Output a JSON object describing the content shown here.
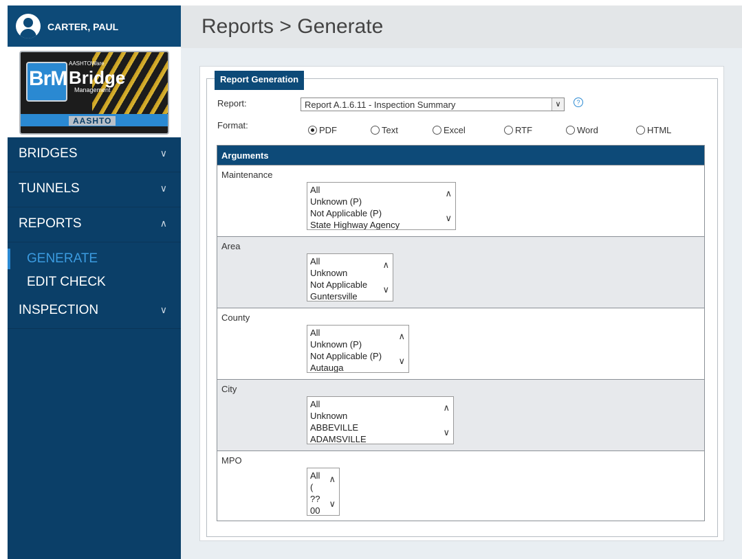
{
  "user": {
    "name": "CARTER, PAUL",
    "icon": "user-avatar-icon"
  },
  "logo": {
    "badge": "BrM",
    "brand_small": "AASHTOWare",
    "brand": "Bridge",
    "sub": "Management",
    "org": "AASHTO"
  },
  "nav": {
    "items": [
      {
        "label": "BRIDGES",
        "chevron": "⌵"
      },
      {
        "label": "TUNNELS",
        "chevron": "⌵"
      },
      {
        "label": "REPORTS",
        "chevron": "^"
      },
      {
        "label": "INSPECTION",
        "chevron": "⌵"
      }
    ],
    "sub_items": [
      {
        "label": "GENERATE"
      },
      {
        "label": "EDIT CHECK"
      }
    ]
  },
  "header": {
    "title": "Reports > Generate"
  },
  "form": {
    "legend": "Report Generation",
    "report_label": "Report:",
    "report_value": "Report A.1.6.11 - Inspection Summary",
    "format_label": "Format:",
    "formats": [
      "PDF",
      "Text",
      "Excel",
      "RTF",
      "Word",
      "HTML"
    ],
    "selected_format": "PDF",
    "help_icon": "?"
  },
  "arguments": {
    "title": "Arguments",
    "rows": [
      {
        "label": "Maintenance",
        "options": [
          "All",
          "Unknown (P)",
          "Not Applicable (P)",
          "State Highway Agency"
        ]
      },
      {
        "label": "Area",
        "options": [
          "All",
          "Unknown",
          "Not Applicable",
          "Guntersville"
        ]
      },
      {
        "label": "County",
        "options": [
          "All",
          "Unknown (P)",
          "Not Applicable (P)",
          "Autauga"
        ]
      },
      {
        "label": "City",
        "options": [
          "All",
          "Unknown",
          "ABBEVILLE",
          "ADAMSVILLE"
        ]
      },
      {
        "label": "MPO",
        "options": [
          "All",
          "(",
          "??",
          "00"
        ]
      }
    ]
  },
  "colors": {
    "sidebar": "#0b3f68",
    "accent": "#2a89d2",
    "header_bar": "#0d4a78",
    "row_alt": "#e7e9ec"
  }
}
